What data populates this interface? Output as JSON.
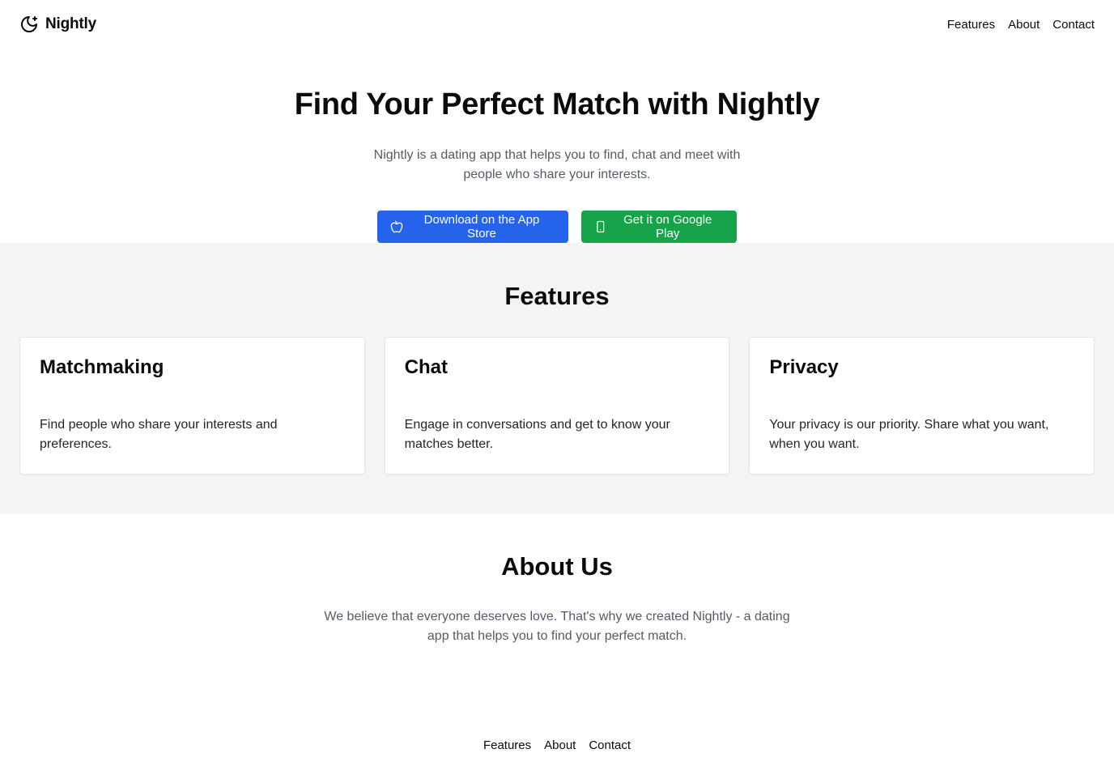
{
  "header": {
    "brand_name": "Nightly",
    "brand_icon": "moon-star-icon",
    "nav": [
      {
        "label": "Features"
      },
      {
        "label": "About"
      },
      {
        "label": "Contact"
      }
    ]
  },
  "hero": {
    "title": "Find Your Perfect Match with Nightly",
    "subtitle": "Nightly is a dating app that helps you to find, chat and meet with people who share your interests.",
    "buttons": {
      "app_store": {
        "label": "Download on the App Store",
        "icon": "apple-icon",
        "color": "#2563eb"
      },
      "google_play": {
        "label": "Get it on Google Play",
        "icon": "smartphone-icon",
        "color": "#16a34a"
      }
    }
  },
  "features": {
    "title": "Features",
    "background": "#f3f4f6",
    "cards": [
      {
        "title": "Matchmaking",
        "text": "Find people who share your interests and preferences."
      },
      {
        "title": "Chat",
        "text": "Engage in conversations and get to know your matches better."
      },
      {
        "title": "Privacy",
        "text": "Your privacy is our priority. Share what you want, when you want."
      }
    ]
  },
  "about": {
    "title": "About Us",
    "text": "We believe that everyone deserves love. That's why we created Nightly - a dating app that helps you to find your perfect match."
  },
  "footer": {
    "nav": [
      {
        "label": "Features"
      },
      {
        "label": "About"
      },
      {
        "label": "Contact"
      }
    ]
  }
}
